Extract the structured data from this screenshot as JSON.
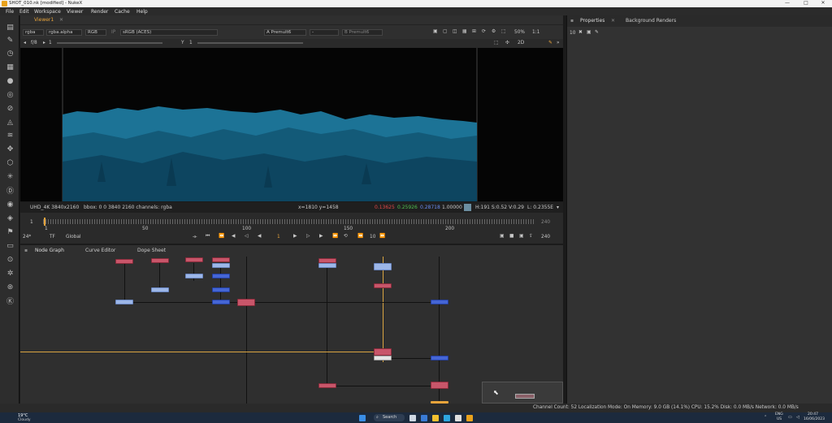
{
  "window": {
    "title": "SHOT_010.nk [modified] - NukeX",
    "minimize": "—",
    "maximize": "□",
    "close": "✕"
  },
  "menu": [
    "File",
    "Edit",
    "Workspace",
    "Viewer",
    "Render",
    "Cache",
    "Help"
  ],
  "viewer_tab": {
    "label": "Viewer1",
    "close": "✕"
  },
  "viewer_controls": {
    "channels": "rgba",
    "alpha": "rgba.alpha",
    "display": "RGB",
    "ip": "IP",
    "lut": "sRGB (ACES)",
    "a_input": "A  Premult6",
    "a_dash": "-",
    "b_input": "B  Premult6",
    "zoom": "50%",
    "ratio": "1:1",
    "fstop": "f/8",
    "frame_field": "1",
    "y_label": "Y",
    "y_value": "1",
    "mode": "2D"
  },
  "image_info": {
    "format": "UHD_4K 3840x2160",
    "bbox": "bbox: 0 0 3840 2160 channels: rgba",
    "coords": "x=1810 y=1458",
    "r": "0.13625",
    "g": "0.25926",
    "b": "0.28718",
    "a": "1.00000",
    "hsv": "H:191 S:0.52 V:0.29",
    "lum": "L: 0.2355E"
  },
  "timeline": {
    "start": "1",
    "ticks": [
      "1",
      "50",
      "100",
      "150",
      "200"
    ],
    "end": "240",
    "fps": "24*",
    "tf": "TF",
    "global": "Global",
    "current_frame": "1",
    "step": "10",
    "end_frame": "240"
  },
  "graph_tabs": [
    "Node Graph",
    "Curve Editor",
    "Dope Sheet"
  ],
  "props_tabs": [
    "Properties",
    "Background Renders"
  ],
  "props_count": "10",
  "status": "Channel Count: 52  Localization Mode: On  Memory: 9.0 GB (14.1%)  CPU: 15.2%  Disk: 0.0 MB/s  Network: 0.0 MB/s",
  "taskbar": {
    "weather_temp": "19°C",
    "weather_desc": "Cloudy",
    "search": "Search",
    "lang": "ENG",
    "region": "US",
    "time": "20:47",
    "date": "16/06/2023"
  },
  "colors": {
    "accent": "#e8a43b",
    "sky": "#1f7fa0",
    "node_red": "#c8566a",
    "node_blue": "#4566d6"
  }
}
